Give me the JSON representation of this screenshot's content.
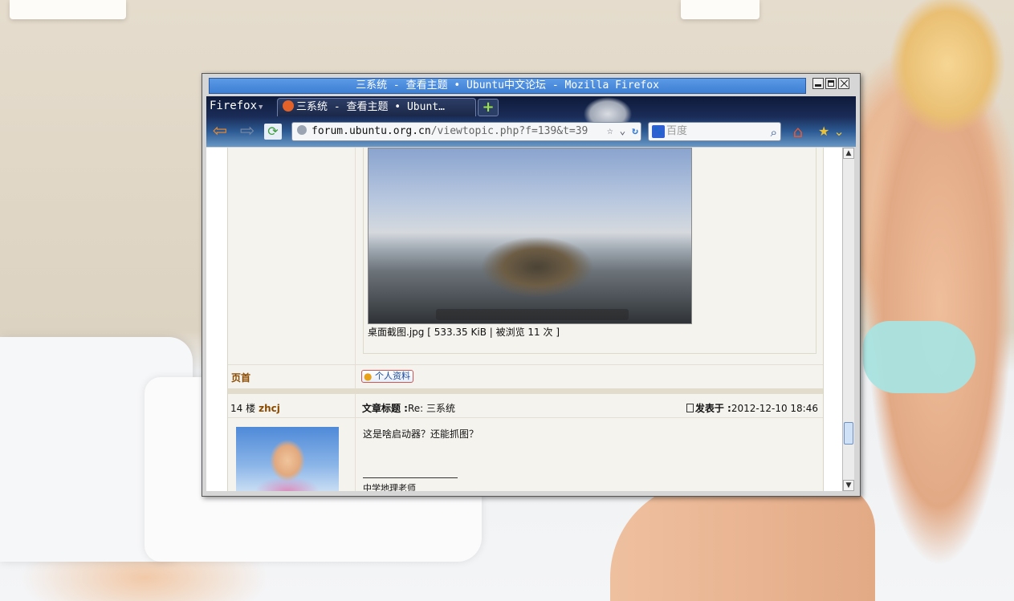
{
  "window": {
    "title": "三系统 - 查看主题 • Ubuntu中文论坛 - Mozilla Firefox"
  },
  "browser": {
    "menu_label": "Firefox",
    "tab_title": "三系统 - 查看主题 • Ubuntu中文论坛",
    "tab_title_shown": "三系统 - 查看主题 • Ubunt…",
    "url_host": "forum.ubuntu.org.cn",
    "url_path": "/viewtopic.php?f=139&t=39",
    "search_placeholder": "百度"
  },
  "post_prev": {
    "attachment_caption": "桌面截图.jpg [ 533.35 KiB | 被浏览 11 次 ]",
    "page_top_label": "页首",
    "profile_button_label": "个人资料"
  },
  "post": {
    "floor": "14 楼",
    "author": "zhcj",
    "subject_label": "文章标题 :",
    "subject": "Re: 三系统",
    "posted_label": "发表于 :",
    "posted_time": "2012-12-10 18:46",
    "body": "这是啥启动器？还能抓图？",
    "signature": "中学地理老师"
  },
  "icons": {
    "back": "back-arrow-icon",
    "forward": "forward-arrow-icon",
    "home": "home-icon",
    "search": "magnifier-icon",
    "bookmark": "bookmark-star-icon"
  }
}
